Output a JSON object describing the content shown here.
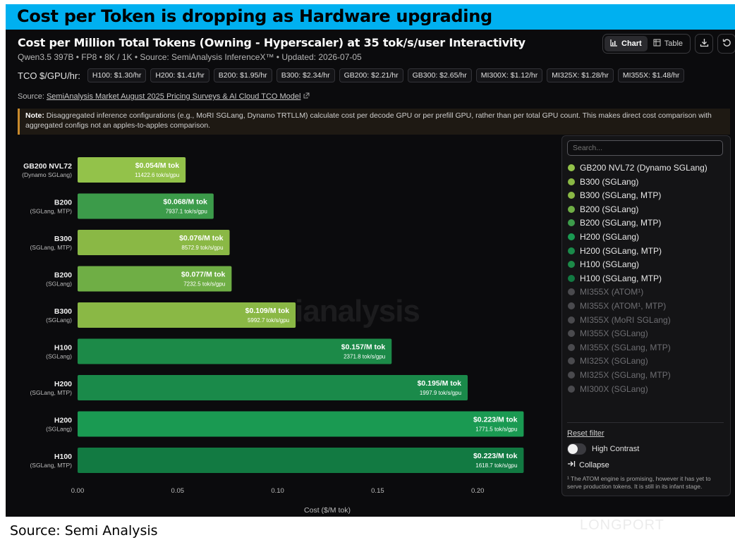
{
  "banner_title": "Cost per Token is dropping as Hardware upgrading",
  "header": {
    "title": "Cost per Million Total Tokens (Owning - Hyperscaler) at 35 tok/s/user Interactivity",
    "subtitle": "Qwen3.5 397B • FP8 • 8K / 1K • Source: SemiAnalysis InferenceX™ • Updated: 2026-07-05",
    "chart_label": "Chart",
    "table_label": "Table"
  },
  "tco": {
    "label": "TCO $/GPU/hr:",
    "chips": [
      "H100: $1.30/hr",
      "H200: $1.41/hr",
      "B200: $1.95/hr",
      "B300: $2.34/hr",
      "GB200: $2.21/hr",
      "GB300: $2.65/hr",
      "MI300X: $1.12/hr",
      "MI325X: $1.28/hr",
      "MI355X: $1.48/hr"
    ]
  },
  "source": {
    "prefix": "Source: ",
    "link": "SemiAnalysis Market August 2025 Pricing Surveys & AI Cloud TCO Model"
  },
  "note": {
    "bold": "Note:",
    "text": " Disaggregated inference configurations (e.g., MoRI SGLang, Dynamo TRTLLM) calculate cost per decode GPU or per prefill GPU, rather than per total GPU count. This makes direct cost comparison with aggregated configs not an apples-to-apples comparison."
  },
  "watermark": "ianalysis",
  "chart_data": {
    "type": "bar",
    "orientation": "horizontal",
    "xlabel": "Cost ($/M tok)",
    "xlim": [
      0,
      0.225
    ],
    "xticks": [
      "0.00",
      "0.05",
      "0.10",
      "0.15",
      "0.20"
    ],
    "xtick_values": [
      0,
      0.05,
      0.1,
      0.15,
      0.2
    ],
    "bars": [
      {
        "name": "GB200 NVL72",
        "config": "(Dynamo SGLang)",
        "value": 0.054,
        "label": "$0.054/M tok",
        "throughput": "11422.6 tok/s/gpu",
        "color": "#93c24a"
      },
      {
        "name": "B200",
        "config": "(SGLang, MTP)",
        "value": 0.068,
        "label": "$0.068/M tok",
        "throughput": "7937.1 tok/s/gpu",
        "color": "#3c9b4a"
      },
      {
        "name": "B300",
        "config": "(SGLang, MTP)",
        "value": 0.076,
        "label": "$0.076/M tok",
        "throughput": "8572.9 tok/s/gpu",
        "color": "#8ab845"
      },
      {
        "name": "B200",
        "config": "(SGLang)",
        "value": 0.077,
        "label": "$0.077/M tok",
        "throughput": "7232.5 tok/s/gpu",
        "color": "#6fae45"
      },
      {
        "name": "B300",
        "config": "(SGLang)",
        "value": 0.109,
        "label": "$0.109/M tok",
        "throughput": "5992.7 tok/s/gpu",
        "color": "#8ab845"
      },
      {
        "name": "H100",
        "config": "(SGLang)",
        "value": 0.157,
        "label": "$0.157/M tok",
        "throughput": "2371.8 tok/s/gpu",
        "color": "#1c8a48"
      },
      {
        "name": "H200",
        "config": "(SGLang, MTP)",
        "value": 0.195,
        "label": "$0.195/M tok",
        "throughput": "1997.9 tok/s/gpu",
        "color": "#1a8a4a"
      },
      {
        "name": "H200",
        "config": "(SGLang)",
        "value": 0.223,
        "label": "$0.223/M tok",
        "throughput": "1771.5 tok/s/gpu",
        "color": "#1a9a52"
      },
      {
        "name": "H100",
        "config": "(SGLang, MTP)",
        "value": 0.223,
        "label": "$0.223/M tok",
        "throughput": "1618.7 tok/s/gpu",
        "color": "#127a42"
      }
    ],
    "legend_placement": "right"
  },
  "legend": {
    "search_placeholder": "Search...",
    "items": [
      {
        "label": "GB200 NVL72 (Dynamo SGLang)",
        "color": "#93c24a",
        "active": true
      },
      {
        "label": "B300 (SGLang)",
        "color": "#8ab845",
        "active": true
      },
      {
        "label": "B300 (SGLang, MTP)",
        "color": "#8ab845",
        "active": true
      },
      {
        "label": "B200 (SGLang)",
        "color": "#6fae45",
        "active": true
      },
      {
        "label": "B200 (SGLang, MTP)",
        "color": "#3c9b4a",
        "active": true
      },
      {
        "label": "H200 (SGLang)",
        "color": "#1a9a52",
        "active": true
      },
      {
        "label": "H200 (SGLang, MTP)",
        "color": "#1a8a4a",
        "active": true
      },
      {
        "label": "H100 (SGLang)",
        "color": "#1c8a48",
        "active": true
      },
      {
        "label": "H100 (SGLang, MTP)",
        "color": "#127a42",
        "active": true
      },
      {
        "label": "MI355X (ATOM¹)",
        "color": "#4a4a4e",
        "active": false
      },
      {
        "label": "MI355X (ATOM¹, MTP)",
        "color": "#4a4a4e",
        "active": false
      },
      {
        "label": "MI355X (MoRI SGLang)",
        "color": "#4a4a4e",
        "active": false
      },
      {
        "label": "MI355X (SGLang)",
        "color": "#4a4a4e",
        "active": false
      },
      {
        "label": "MI355X (SGLang, MTP)",
        "color": "#4a4a4e",
        "active": false
      },
      {
        "label": "MI325X (SGLang)",
        "color": "#4a4a4e",
        "active": false
      },
      {
        "label": "MI325X (SGLang, MTP)",
        "color": "#4a4a4e",
        "active": false
      },
      {
        "label": "MI300X (SGLang)",
        "color": "#4a4a4e",
        "active": false
      }
    ],
    "reset_filter": "Reset filter",
    "high_contrast": "High Contrast",
    "collapse": "Collapse",
    "footnote": "¹ The ATOM engine is promising, however it has yet to serve production tokens. It is still in its infant stage."
  },
  "caption": "Source: Semi Analysis",
  "brand_watermark": "LONGPORT"
}
